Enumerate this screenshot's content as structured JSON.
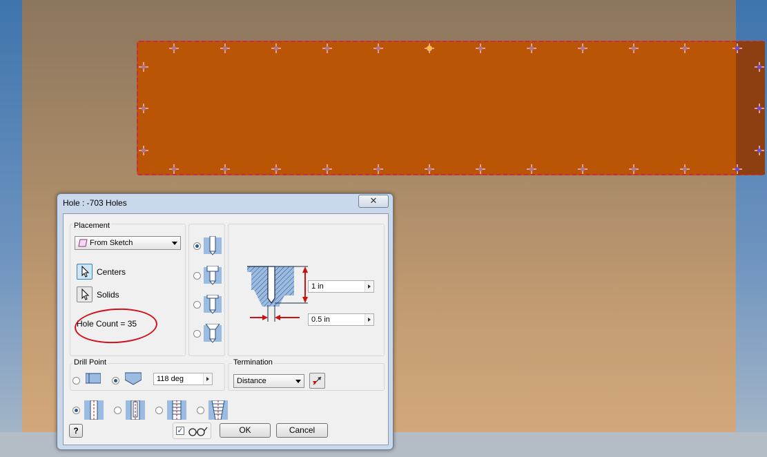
{
  "dialog": {
    "title": "Hole : -703 Holes",
    "close_symbol": "✕",
    "placement": {
      "label": "Placement",
      "method": "From Sketch",
      "centers_label": "Centers",
      "solids_label": "Solids",
      "hole_count": "Hole Count = 35"
    },
    "hole_types": [
      {
        "name": "drilled",
        "selected": true
      },
      {
        "name": "counterbore",
        "selected": false
      },
      {
        "name": "spotface",
        "selected": false
      },
      {
        "name": "countersink",
        "selected": false
      }
    ],
    "preview": {
      "depth": "1 in",
      "diameter": "0.5 in"
    },
    "drill_point": {
      "label": "Drill Point",
      "options": [
        "flat",
        "angle"
      ],
      "selected": "angle",
      "angle": "118 deg"
    },
    "termination": {
      "label": "Termination",
      "value": "Distance"
    },
    "thread_types": [
      {
        "name": "simple-hole",
        "selected": true
      },
      {
        "name": "clearance-hole",
        "selected": false
      },
      {
        "name": "tapped-hole",
        "selected": false
      },
      {
        "name": "taper-tapped-hole",
        "selected": false
      }
    ],
    "preview_checked": true,
    "ok_label": "OK",
    "cancel_label": "Cancel",
    "help_symbol": "?"
  },
  "colors": {
    "plate": "#b95505",
    "plate_edge": "#c8284a",
    "annotation": "#d0101a",
    "dimension_arrows": "#cc1111"
  }
}
